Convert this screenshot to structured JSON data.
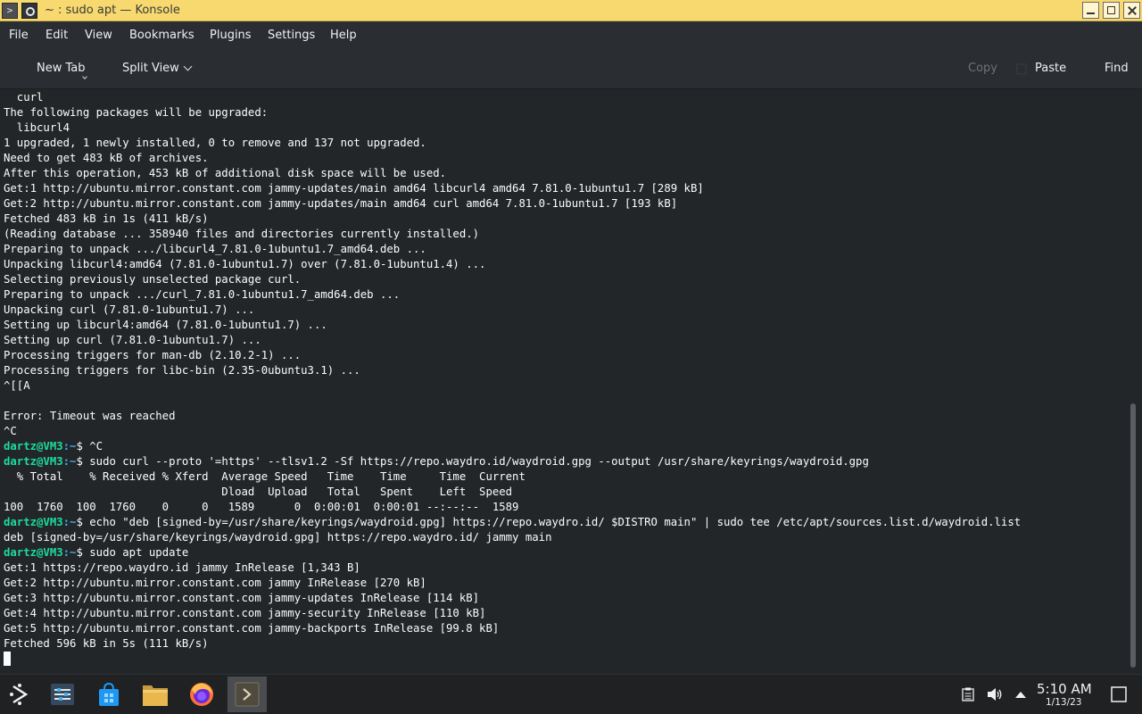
{
  "window": {
    "title": "~ : sudo apt — Konsole",
    "app_icon": "terminal-icon",
    "pin_icon": "pin-icon"
  },
  "menu": {
    "items": [
      "File",
      "Edit",
      "View",
      "Bookmarks",
      "Plugins",
      "Settings",
      "Help"
    ]
  },
  "toolbar": {
    "new_tab": "New Tab",
    "split_view": "Split View",
    "copy": "Copy",
    "paste": "Paste",
    "find": "Find"
  },
  "terminal": {
    "prompt_user": "dartz@VM3",
    "prompt_path": ":~",
    "lines": [
      {
        "text": "  curl"
      },
      {
        "text": "The following packages will be upgraded:"
      },
      {
        "text": "  libcurl4"
      },
      {
        "text": "1 upgraded, 1 newly installed, 0 to remove and 137 not upgraded."
      },
      {
        "text": "Need to get 483 kB of archives."
      },
      {
        "text": "After this operation, 453 kB of additional disk space will be used."
      },
      {
        "text": "Get:1 http://ubuntu.mirror.constant.com jammy-updates/main amd64 libcurl4 amd64 7.81.0-1ubuntu1.7 [289 kB]"
      },
      {
        "text": "Get:2 http://ubuntu.mirror.constant.com jammy-updates/main amd64 curl amd64 7.81.0-1ubuntu1.7 [193 kB]"
      },
      {
        "text": "Fetched 483 kB in 1s (411 kB/s)"
      },
      {
        "text": "(Reading database ... 358940 files and directories currently installed.)"
      },
      {
        "text": "Preparing to unpack .../libcurl4_7.81.0-1ubuntu1.7_amd64.deb ..."
      },
      {
        "text": "Unpacking libcurl4:amd64 (7.81.0-1ubuntu1.7) over (7.81.0-1ubuntu1.4) ..."
      },
      {
        "text": "Selecting previously unselected package curl."
      },
      {
        "text": "Preparing to unpack .../curl_7.81.0-1ubuntu1.7_amd64.deb ..."
      },
      {
        "text": "Unpacking curl (7.81.0-1ubuntu1.7) ..."
      },
      {
        "text": "Setting up libcurl4:amd64 (7.81.0-1ubuntu1.7) ..."
      },
      {
        "text": "Setting up curl (7.81.0-1ubuntu1.7) ..."
      },
      {
        "text": "Processing triggers for man-db (2.10.2-1) ..."
      },
      {
        "text": "Processing triggers for libc-bin (2.35-0ubuntu3.1) ..."
      },
      {
        "text": "^[[A"
      },
      {
        "text": ""
      },
      {
        "text": "Error: Timeout was reached"
      },
      {
        "text": "^C"
      },
      {
        "prompt": true,
        "text": "$ ^C"
      },
      {
        "prompt": true,
        "text": "$ sudo curl --proto '=https' --tlsv1.2 -Sf https://repo.waydro.id/waydroid.gpg --output /usr/share/keyrings/waydroid.gpg"
      },
      {
        "text": "  % Total    % Received % Xferd  Average Speed   Time    Time     Time  Current"
      },
      {
        "text": "                                 Dload  Upload   Total   Spent    Left  Speed"
      },
      {
        "text": "100  1760  100  1760    0     0   1589      0  0:00:01  0:00:01 --:--:--  1589"
      },
      {
        "prompt": true,
        "text": "$ echo \"deb [signed-by=/usr/share/keyrings/waydroid.gpg] https://repo.waydro.id/ $DISTRO main\" | sudo tee /etc/apt/sources.list.d/waydroid.list"
      },
      {
        "text": "deb [signed-by=/usr/share/keyrings/waydroid.gpg] https://repo.waydro.id/ jammy main"
      },
      {
        "prompt": true,
        "text": "$ sudo apt update"
      },
      {
        "text": "Get:1 https://repo.waydro.id jammy InRelease [1,343 B]"
      },
      {
        "text": "Get:2 http://ubuntu.mirror.constant.com jammy InRelease [270 kB]"
      },
      {
        "text": "Get:3 http://ubuntu.mirror.constant.com jammy-updates InRelease [114 kB]"
      },
      {
        "text": "Get:4 http://ubuntu.mirror.constant.com jammy-security InRelease [110 kB]"
      },
      {
        "text": "Get:5 http://ubuntu.mirror.constant.com jammy-backports InRelease [99.8 kB]"
      },
      {
        "text": "Fetched 596 kB in 5s (111 kB/s)"
      },
      {
        "cursor": true,
        "text": ""
      }
    ]
  },
  "taskbar": {
    "items": [
      {
        "name": "application-launcher-icon"
      },
      {
        "name": "system-settings-icon"
      },
      {
        "name": "discover-store-icon"
      },
      {
        "name": "file-manager-icon"
      },
      {
        "name": "firefox-icon"
      },
      {
        "name": "konsole-icon",
        "active": true
      }
    ],
    "tray": [
      "clipboard-icon",
      "volume-icon",
      "tray-expand-icon"
    ],
    "clock_time": "5:10 AM",
    "clock_date": "1/13/23",
    "show_desktop": "show-desktop-icon"
  },
  "colors": {
    "titlebar": "#f7d96f",
    "background": "#232629",
    "prompt_user": "#1cdc9a",
    "prompt_path": "#3daee9"
  }
}
